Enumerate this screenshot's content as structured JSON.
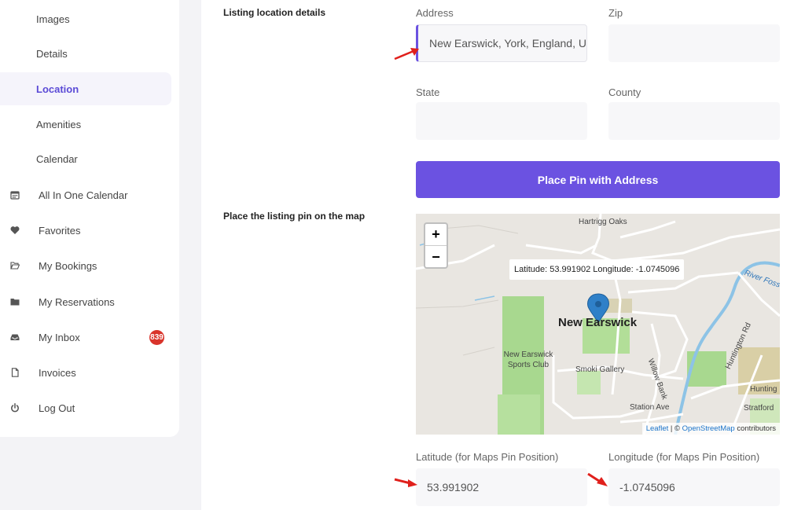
{
  "sidebar": {
    "sub_items": [
      {
        "label": "Images"
      },
      {
        "label": "Details"
      },
      {
        "label": "Location"
      },
      {
        "label": "Amenities"
      },
      {
        "label": "Calendar"
      }
    ],
    "nav_items": [
      {
        "label": "All In One Calendar",
        "icon": "calendar-icon"
      },
      {
        "label": "Favorites",
        "icon": "heart-icon"
      },
      {
        "label": "My Bookings",
        "icon": "folder-open-icon"
      },
      {
        "label": "My Reservations",
        "icon": "folder-icon"
      },
      {
        "label": "My Inbox",
        "icon": "inbox-icon",
        "badge": "839"
      },
      {
        "label": "Invoices",
        "icon": "document-icon"
      },
      {
        "label": "Log Out",
        "icon": "power-icon"
      }
    ]
  },
  "main": {
    "location_section_title": "Listing location details",
    "address_label": "Address",
    "address_value": "New Earswick, York, England, U",
    "zip_label": "Zip",
    "zip_value": "",
    "state_label": "State",
    "state_value": "",
    "county_label": "County",
    "county_value": "",
    "place_pin_button": "Place Pin with Address",
    "map_section_title": "Place the listing pin on the map",
    "map": {
      "zoom_in": "+",
      "zoom_out": "−",
      "popup": "Latitude: 53.991902 Longitude: -1.0745096",
      "places": [
        "Hartrigg Oaks",
        "New Earswick",
        "New Earswick Sports Club",
        "Smoki Gallery",
        "Station Ave",
        "Willow Bank",
        "Huntington Rd",
        "River Foss",
        "Hunting",
        "Stratford"
      ],
      "attribution_link1": "Leaflet",
      "attribution_sep": " | © ",
      "attribution_link2": "OpenStreetMap",
      "attribution_suffix": " contributors"
    },
    "latitude_label": "Latitude (for Maps Pin Position)",
    "latitude_value": "53.991902",
    "longitude_label": "Longitude (for Maps Pin Position)",
    "longitude_value": "-1.0745096"
  },
  "colors": {
    "accent": "#6b52e1",
    "badge": "#d9342b",
    "annotation_arrow": "#e0201c"
  }
}
